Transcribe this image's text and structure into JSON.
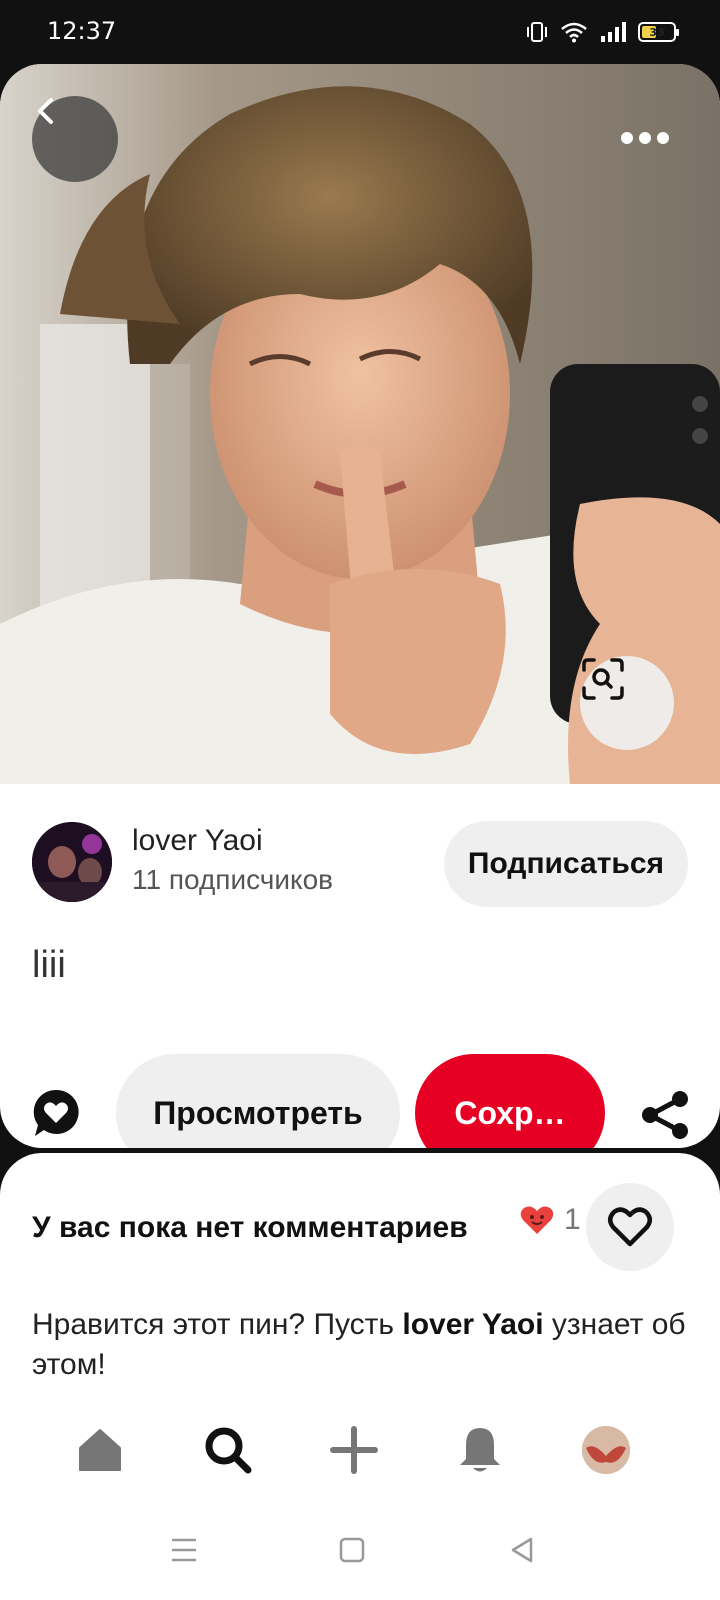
{
  "status_bar": {
    "time": "12:37",
    "battery_level": "33",
    "icons": [
      "vibrate-icon",
      "wifi-icon",
      "signal-icon",
      "battery-icon"
    ]
  },
  "pin": {
    "image_description": "photo",
    "creator": {
      "name": "lover Yaoi",
      "followers": "11 подписчиков"
    },
    "follow_label": "Подписаться",
    "title": "liii",
    "view_label": "Просмотреть",
    "save_label": "Сохр…"
  },
  "comments": {
    "empty_label": "У вас пока нет комментариев",
    "reaction_count": "1",
    "prompt_before": "Нравится этот пин? Пусть ",
    "prompt_name": "lover Yaoi",
    "prompt_after": " узнает об этом!"
  },
  "bottom_nav": {
    "items": [
      "home-icon",
      "search-icon",
      "create-icon",
      "notifications-icon",
      "profile-avatar"
    ],
    "active": "search-icon"
  },
  "colors": {
    "accent": "#e60023",
    "neutral_button": "#efefef",
    "reaction_heart": "#e9423e"
  }
}
